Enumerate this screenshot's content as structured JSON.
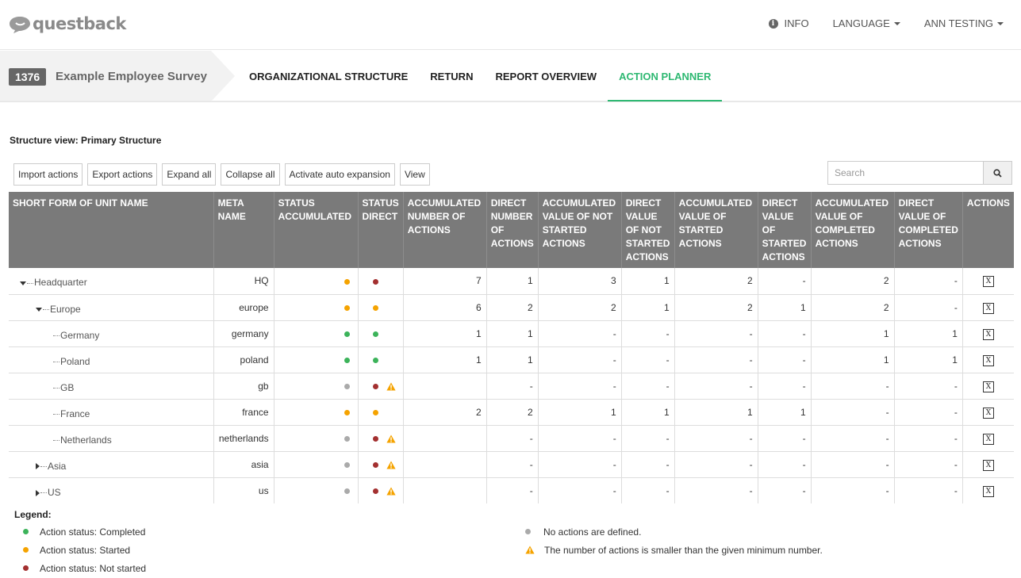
{
  "app": {
    "logo_text": "questback"
  },
  "topnav": {
    "info": "INFO",
    "language": "LANGUAGE",
    "user": "ANN TESTING"
  },
  "project": {
    "id": "1376",
    "name": "Example Employee Survey"
  },
  "tabs": [
    {
      "label": "ORGANIZATIONAL STRUCTURE"
    },
    {
      "label": "RETURN"
    },
    {
      "label": "REPORT OVERVIEW"
    },
    {
      "label": "ACTION PLANNER"
    }
  ],
  "structure_view": "Structure view: Primary Structure",
  "toolbar": {
    "import": "Import actions",
    "export": "Export actions",
    "expand": "Expand all",
    "collapse": "Collapse all",
    "auto": "Activate auto expansion",
    "view": "View"
  },
  "search": {
    "placeholder": "Search"
  },
  "colors": {
    "green": "#3cb35a",
    "orange": "#f5a300",
    "red": "#a33030",
    "gray": "#aaaaaa",
    "accent": "#2eb872"
  },
  "table": {
    "headers": [
      "SHORT FORM OF UNIT NAME",
      "META NAME",
      "STATUS ACCUMULATED",
      "STATUS DIRECT",
      "ACCUMULATED NUMBER OF ACTIONS",
      "DIRECT NUMBER OF ACTIONS",
      "ACCUMULATED VALUE OF NOT STARTED ACTIONS",
      "DIRECT VALUE OF NOT STARTED ACTIONS",
      "ACCUMULATED VALUE OF STARTED ACTIONS",
      "DIRECT VALUE OF STARTED ACTIONS",
      "ACCUMULATED VALUE OF COMPLETED ACTIONS",
      "DIRECT VALUE OF COMPLETED ACTIONS",
      "ACTIONS"
    ],
    "rows": [
      {
        "unit": "Headquarter",
        "meta": "HQ",
        "acc": "7",
        "dir": "1",
        "ans": "3",
        "dns": "1",
        "as": "2",
        "ds": "-",
        "ac": "2",
        "dc": "-"
      },
      {
        "unit": "Europe",
        "meta": "europe",
        "acc": "6",
        "dir": "2",
        "ans": "2",
        "dns": "1",
        "as": "2",
        "ds": "1",
        "ac": "2",
        "dc": "-"
      },
      {
        "unit": "Germany",
        "meta": "germany",
        "acc": "1",
        "dir": "1",
        "ans": "-",
        "dns": "-",
        "as": "-",
        "ds": "-",
        "ac": "1",
        "dc": "1"
      },
      {
        "unit": "Poland",
        "meta": "poland",
        "acc": "1",
        "dir": "1",
        "ans": "-",
        "dns": "-",
        "as": "-",
        "ds": "-",
        "ac": "1",
        "dc": "1"
      },
      {
        "unit": "GB",
        "meta": "gb",
        "acc": "",
        "dir": "-",
        "ans": "-",
        "dns": "-",
        "as": "-",
        "ds": "-",
        "ac": "-",
        "dc": "-"
      },
      {
        "unit": "France",
        "meta": "france",
        "acc": "2",
        "dir": "2",
        "ans": "1",
        "dns": "1",
        "as": "1",
        "ds": "1",
        "ac": "-",
        "dc": "-"
      },
      {
        "unit": "Netherlands",
        "meta": "netherlands",
        "acc": "",
        "dir": "-",
        "ans": "-",
        "dns": "-",
        "as": "-",
        "ds": "-",
        "ac": "-",
        "dc": "-"
      },
      {
        "unit": "Asia",
        "meta": "asia",
        "acc": "",
        "dir": "-",
        "ans": "-",
        "dns": "-",
        "as": "-",
        "ds": "-",
        "ac": "-",
        "dc": "-"
      },
      {
        "unit": "US",
        "meta": "us",
        "acc": "",
        "dir": "-",
        "ans": "-",
        "dns": "-",
        "as": "-",
        "ds": "-",
        "ac": "-",
        "dc": "-"
      }
    ]
  },
  "legend": {
    "title": "Legend:",
    "completed": "Action status: Completed",
    "started": "Action status: Started",
    "not_started": "Action status: Not started",
    "none": "No actions are defined.",
    "min": "The number of actions is smaller than the given minimum number."
  }
}
